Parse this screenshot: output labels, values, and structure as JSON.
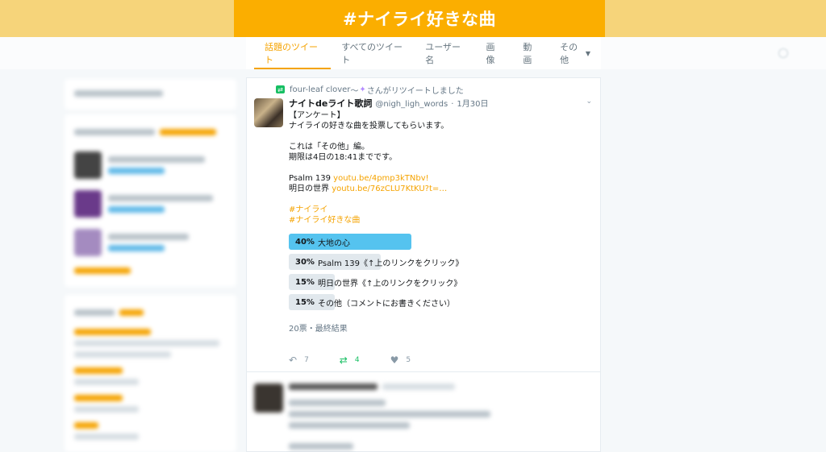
{
  "page": {
    "title": "#ナイライ好きな曲"
  },
  "nav": {
    "tabs": [
      {
        "label": "話題のツイート",
        "active": true
      },
      {
        "label": "すべてのツイート"
      },
      {
        "label": "ユーザー名"
      },
      {
        "label": "画像"
      },
      {
        "label": "動画"
      },
      {
        "label": "その他"
      }
    ]
  },
  "tweet": {
    "retweeted_by": "four-leaf clover",
    "retweeted_by_suffix": "〜",
    "retweet_text": "さんがリツイートしました",
    "author_name": "ナイトdeライト歌詞",
    "author_handle": "@nigh_ligh_words",
    "date": "1月30日",
    "lines": {
      "l1": "【アンケート】",
      "l2": "ナイライの好きな曲を投票してもらいます。",
      "l3": "これは「その他」編。",
      "l4": "期限は4日の18:41までです。",
      "l5a": "Psalm 139 ",
      "l5b": "youtu.be/4pmp3kTNbv!",
      "l6a": "明日の世界 ",
      "l6b": "youtu.be/76zCLU7KtKU?t=…",
      "tag1": "#ナイライ",
      "tag2": "#ナイライ好きな曲"
    },
    "poll": [
      {
        "pct": "40%",
        "label": "大地の心",
        "value": 40,
        "winner": true
      },
      {
        "pct": "30%",
        "label": "Psalm 139《↑上のリンクをクリック》",
        "value": 30
      },
      {
        "pct": "15%",
        "label": "明日の世界《↑上のリンクをクリック》",
        "value": 15
      },
      {
        "pct": "15%",
        "label": "その他（コメントにお書きください）",
        "value": 15
      }
    ],
    "poll_meta": "20票・最終結果",
    "reply_count": "7",
    "retweet_count": "4",
    "like_count": "5"
  },
  "colors": {
    "accent": "#f5a300",
    "banner": "#fbae00",
    "poll_winner": "#55c3ef",
    "retweet": "#17bf63"
  },
  "icons": {
    "reply": "reply-icon",
    "retweet": "retweet-icon",
    "like": "heart-icon",
    "caret": "chevron-down-icon"
  }
}
